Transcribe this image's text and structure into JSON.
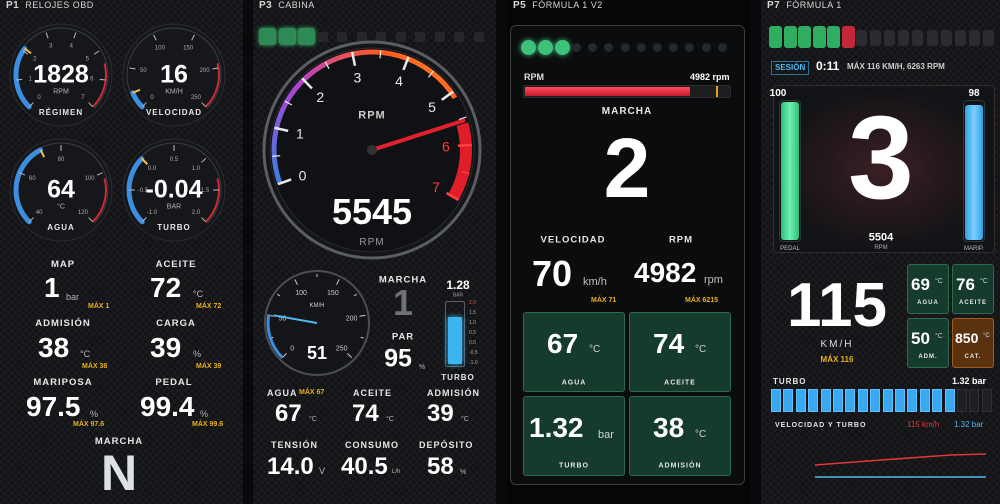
{
  "p1": {
    "page_num": "P1",
    "title": "RELOJES OBD",
    "gauges": [
      {
        "value": "1828",
        "unit": "RPM",
        "label": "RÉGIMEN",
        "ticks": [
          "0",
          "1",
          "2",
          "3",
          "4",
          "5",
          "6",
          "7"
        ]
      },
      {
        "value": "16",
        "unit": "KM/H",
        "label": "VELOCIDAD",
        "ticks": [
          "0",
          "50",
          "100",
          "150",
          "200",
          "250"
        ]
      },
      {
        "value": "64",
        "unit": "°C",
        "label": "AGUA",
        "ticks": [
          "40",
          "60",
          "80",
          "100",
          "120"
        ]
      },
      {
        "value": "-0.04",
        "unit": "BAR",
        "label": "TURBO",
        "ticks": [
          "-1.0",
          "-0.5",
          "0.0",
          "0.5",
          "1.0",
          "1.5",
          "2.0"
        ]
      }
    ],
    "readings": [
      {
        "label": "MAP",
        "value": "1",
        "unit": "bar",
        "max": "MÁX 1"
      },
      {
        "label": "ACEITE",
        "value": "72",
        "unit": "°C",
        "max": "MÁX 72"
      },
      {
        "label": "ADMISIÓN",
        "value": "38",
        "unit": "°C",
        "max": "MÁX 38"
      },
      {
        "label": "CARGA",
        "value": "39",
        "unit": "%",
        "max": "MÁX 39"
      },
      {
        "label": "MARIPOSA",
        "value": "97.5",
        "unit": "%",
        "max": "MÁX 97.6"
      },
      {
        "label": "PEDAL",
        "value": "99.4",
        "unit": "%",
        "max": "MÁX 99.6"
      }
    ],
    "gear_label": "MARCHA",
    "gear": "N"
  },
  "p3": {
    "page_num": "P3",
    "title": "CABINA",
    "shift_leds": {
      "on": 3,
      "total": 12
    },
    "rpm_gauge": {
      "ticks": [
        "0",
        "1",
        "2",
        "3",
        "4",
        "5",
        "6",
        "7"
      ],
      "label": "RPM",
      "value": "5545",
      "unit": "RPM",
      "needle_rpm": 5.545
    },
    "speed_gauge": {
      "ticks": [
        "0",
        "50",
        "100",
        "150",
        "200",
        "250"
      ],
      "unit": "KM/H",
      "value": "51",
      "needle_kmh": 51
    },
    "gear_label": "MARCHA",
    "gear": "1",
    "torque_label": "PAR",
    "torque": "95",
    "torque_unit": "%",
    "turbo": {
      "value": "1.28",
      "unit": "BAR",
      "label": "TURBO",
      "ticks": [
        "2.0",
        "1.5",
        "1.0",
        "0.5",
        "0.0",
        "-0.5",
        "-1.0"
      ],
      "level": 0.76
    },
    "readings": [
      {
        "label": "AGUA",
        "value": "67",
        "unit": "°C",
        "max": "MÁX 67"
      },
      {
        "label": "ACEITE",
        "value": "74",
        "unit": "°C"
      },
      {
        "label": "ADMISIÓN",
        "value": "39",
        "unit": "°C"
      },
      {
        "label": "TENSIÓN",
        "value": "14.0",
        "unit": "V"
      },
      {
        "label": "CONSUMO",
        "value": "40.5",
        "unit": "L/h"
      },
      {
        "label": "DEPÓSITO",
        "value": "58",
        "unit": "%"
      }
    ]
  },
  "p5": {
    "page_num": "P5",
    "title": "FÓRMULA 1 V2",
    "shift_leds": {
      "on": 3,
      "total": 13
    },
    "rpm_label": "RPM",
    "rpm_value": "4982 rpm",
    "rpm_bar_fraction": 0.8,
    "gear_label": "MARCHA",
    "gear": "2",
    "speed_label": "VELOCIDAD",
    "speed": "70",
    "speed_unit": "km/h",
    "speed_max": "MÁX 71",
    "rpm2_label": "RPM",
    "rpm2": "4982",
    "rpm2_unit": "rpm",
    "rpm2_max": "MÁX 6215",
    "tiles": [
      {
        "label": "AGUA",
        "value": "67",
        "unit": "°C"
      },
      {
        "label": "ACEITE",
        "value": "74",
        "unit": "°C"
      },
      {
        "label": "TURBO",
        "value": "1.32",
        "unit": "bar"
      },
      {
        "label": "ADMISIÓN",
        "value": "38",
        "unit": "°C"
      }
    ]
  },
  "p7": {
    "page_num": "P7",
    "title": "FÓRMULA 1",
    "shift_leds": {
      "green": 5,
      "red": 1,
      "total": 16
    },
    "session_label": "SESIÓN",
    "session_time": "0:11",
    "session_max": "MÁX  116 KM/H, 6263 RPM",
    "pedal_label": "PEDAL",
    "pedal_value": "100",
    "pedal_fraction": 1.0,
    "marip_label": "MARIP.",
    "marip_value": "98",
    "marip_fraction": 0.98,
    "gear": "3",
    "rpm": "5504",
    "rpm_unit": "RPM",
    "speed": "115",
    "speed_unit": "KM/H",
    "speed_max": "MÁX 116",
    "tiles": [
      {
        "label": "AGUA",
        "value": "69",
        "unit": "°C"
      },
      {
        "label": "ACEITE",
        "value": "76",
        "unit": "°C"
      },
      {
        "label": "ADM.",
        "value": "50",
        "unit": "°C"
      },
      {
        "label": "CAT.",
        "value": "850",
        "unit": "°C"
      }
    ],
    "turbo_label": "TURBO",
    "turbo_value": "1.32 bar",
    "turbo_segments": {
      "lit": 15,
      "total": 18
    },
    "chart_label": "VELOCIDAD Y TURBO",
    "chart_speed": "115 km/h",
    "chart_turbo": "1.32 bar"
  }
}
